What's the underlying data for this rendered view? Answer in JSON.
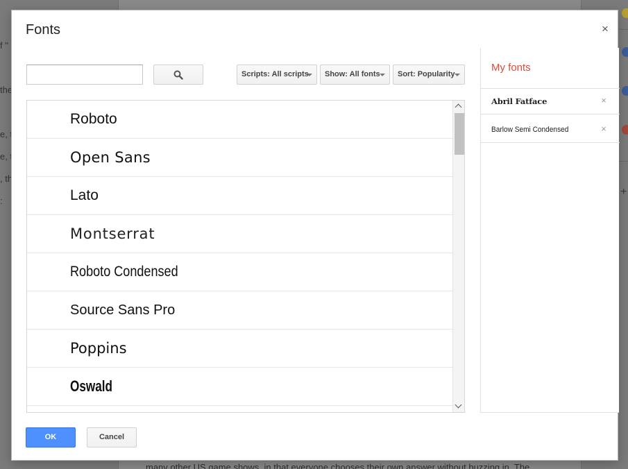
{
  "background": {
    "left_fragments": [
      "f \"",
      "the",
      "e, th",
      "e, t",
      ", th",
      ":"
    ],
    "bottom_text": "many other US game shows, in that everyone chooses their own answer without buzzing in. The"
  },
  "dialog": {
    "title": "Fonts",
    "close_label": "×",
    "search": {
      "value": "",
      "placeholder": ""
    },
    "filters": {
      "scripts_label": "Scripts: All scripts",
      "show_label": "Show: All fonts",
      "sort_label": "Sort: Popularity"
    },
    "fonts": [
      {
        "label": "Roboto"
      },
      {
        "label": "Open Sans"
      },
      {
        "label": "Lato"
      },
      {
        "label": "Montserrat"
      },
      {
        "label": "Roboto Condensed"
      },
      {
        "label": "Source Sans Pro"
      },
      {
        "label": "Poppins"
      },
      {
        "label": "Oswald"
      }
    ],
    "my_fonts": {
      "title": "My fonts",
      "items": [
        {
          "label": "Abril Fatface",
          "remove_label": "×"
        },
        {
          "label": "Barlow Semi Condensed",
          "remove_label": "×"
        }
      ]
    },
    "buttons": {
      "ok_label": "OK",
      "cancel_label": "Cancel"
    }
  },
  "colors": {
    "accent_red": "#dd4b39",
    "primary_blue": "#4d90fe"
  }
}
